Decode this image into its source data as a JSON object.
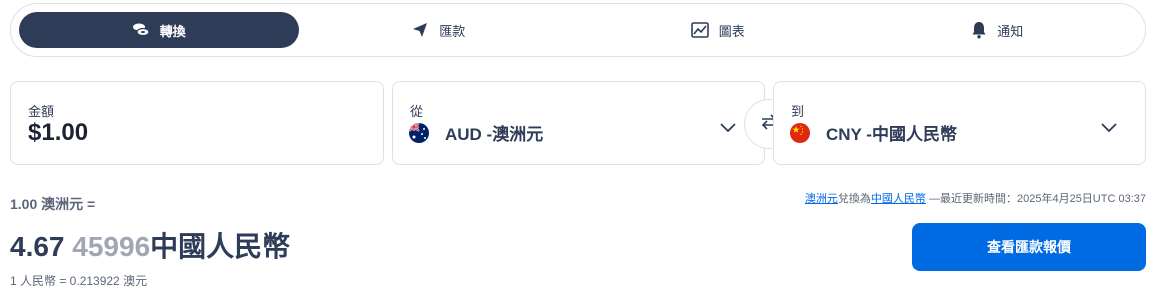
{
  "tabs": [
    {
      "label": "轉換",
      "icon": "money-icon",
      "active": true
    },
    {
      "label": "匯款",
      "icon": "send-icon",
      "active": false
    },
    {
      "label": "圖表",
      "icon": "chart-icon",
      "active": false
    },
    {
      "label": "通知",
      "icon": "bell-icon",
      "active": false
    }
  ],
  "amount": {
    "label": "金額",
    "value": "$1.00"
  },
  "from": {
    "label": "從",
    "code_name": "AUD -澳洲元",
    "flag": "australia-flag-icon"
  },
  "to": {
    "label": "到",
    "code_name": "CNY -中國人民幣",
    "flag": "china-flag-icon"
  },
  "result": {
    "base_line": "1.00 澳洲元 =",
    "value_main": "4.67",
    "value_faded": "45996",
    "currency_name": "中國人民幣",
    "inverse_line": "1 人民幣 = 0.213922 澳元"
  },
  "disclaimer": {
    "from_link": "澳洲元",
    "convert_text": "兌換為",
    "to_link": "中國人民幣",
    "updated_text": "—最近更新時間：2025年4月25日UTC 03:37"
  },
  "cta_label": "查看匯款報價",
  "colors": {
    "primary": "#006ae3",
    "navy": "#2e3c57"
  }
}
